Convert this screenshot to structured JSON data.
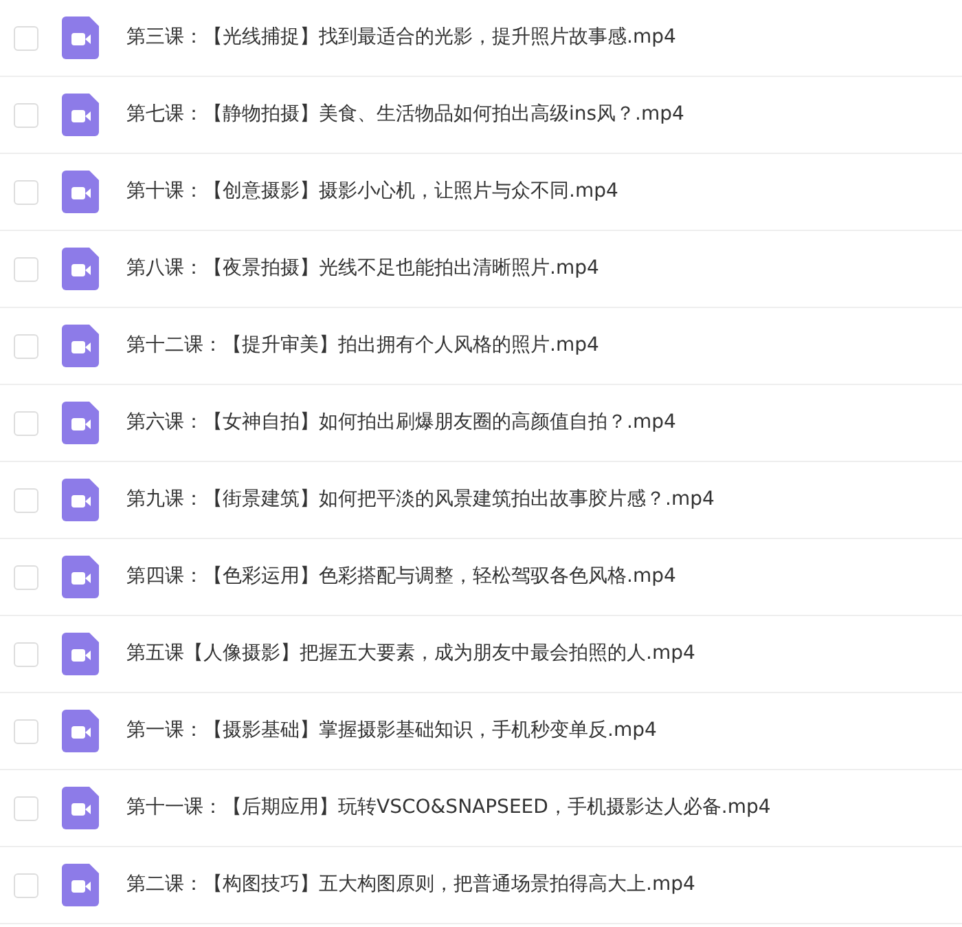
{
  "files": [
    {
      "name": "第三课：【光线捕捉】找到最适合的光影，提升照片故事感.mp4",
      "checked": false
    },
    {
      "name": "第七课：【静物拍摄】美食、生活物品如何拍出高级ins风？.mp4",
      "checked": false
    },
    {
      "name": "第十课：【创意摄影】摄影小心机，让照片与众不同.mp4",
      "checked": false
    },
    {
      "name": "第八课：【夜景拍摄】光线不足也能拍出清晰照片.mp4",
      "checked": false
    },
    {
      "name": "第十二课：【提升审美】拍出拥有个人风格的照片.mp4",
      "checked": false
    },
    {
      "name": "第六课：【女神自拍】如何拍出刷爆朋友圈的高颜值自拍？.mp4",
      "checked": false
    },
    {
      "name": "第九课：【街景建筑】如何把平淡的风景建筑拍出故事胶片感？.mp4",
      "checked": false
    },
    {
      "name": "第四课：【色彩运用】色彩搭配与调整，轻松驾驭各色风格.mp4",
      "checked": false
    },
    {
      "name": "第五课【人像摄影】把握五大要素，成为朋友中最会拍照的人.mp4",
      "checked": false
    },
    {
      "name": "第一课：【摄影基础】掌握摄影基础知识，手机秒变单反.mp4",
      "checked": false
    },
    {
      "name": "第十一课：【后期应用】玩转VSCO&SNAPSEED，手机摄影达人必备.mp4",
      "checked": false
    },
    {
      "name": "第二课：【构图技巧】五大构图原则，把普通场景拍得高大上.mp4",
      "checked": false
    }
  ]
}
